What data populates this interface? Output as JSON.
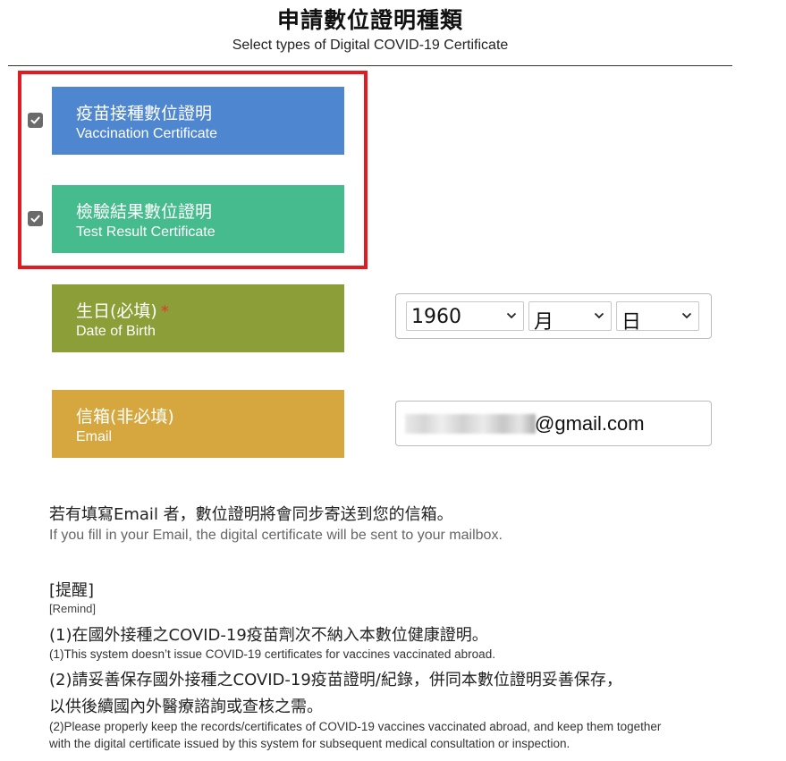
{
  "header": {
    "title_zh": "申請數位證明種類",
    "title_en": "Select types of Digital COVID-19 Certificate"
  },
  "certificates": [
    {
      "label_zh": "疫苗接種數位證明",
      "label_en": "Vaccination Certificate",
      "checked": true,
      "color": "#4e86cf"
    },
    {
      "label_zh": "檢驗結果數位證明",
      "label_en": "Test Result Certificate",
      "checked": true,
      "color": "#46bc8e"
    }
  ],
  "dob": {
    "label_zh": "生日(必填)",
    "required_mark": "*",
    "label_en": "Date of Birth",
    "year": "1960",
    "month": "月",
    "day": "日",
    "color": "#8c9e37"
  },
  "email": {
    "label_zh": "信箱(非必填)",
    "label_en": "Email",
    "value_visible": "@gmail.com",
    "color": "#d6a73f"
  },
  "notice": {
    "zh": "若有填寫Email 者，數位證明將會同步寄送到您的信箱。",
    "en": "If you fill in your Email, the digital certificate will be sent to your mailbox."
  },
  "remind": {
    "heading_zh": "[提醒]",
    "heading_en": "[Remind]",
    "p1_zh": "(1)在國外接種之COVID-19疫苗劑次不納入本數位健康證明。",
    "p1_en": "(1)This system doesn’t issue COVID-19 certificates for vaccines vaccinated abroad.",
    "p2_zh_line1": "(2)請妥善保存國外接種之COVID-19疫苗證明/紀錄，併同本數位證明妥善保存，",
    "p2_zh_line2": "以供後續國內外醫療諮詢或查核之需。",
    "p2_en_line1": "(2)Please properly keep the records/certificates of COVID-19 vaccines vaccinated abroad, and keep them together",
    "p2_en_line2": "with the digital certificate issued by this system for subsequent medical consultation or inspection."
  }
}
